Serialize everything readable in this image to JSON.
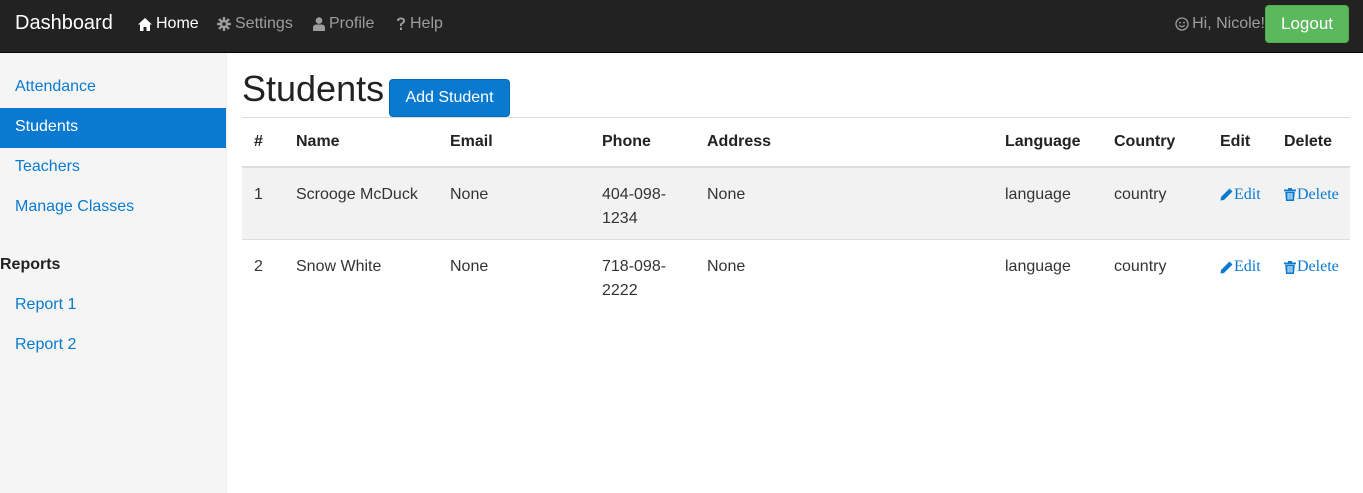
{
  "navbar": {
    "brand": "Dashboard",
    "items": [
      {
        "label": "Home",
        "icon": "home-icon",
        "active": true
      },
      {
        "label": "Settings",
        "icon": "gear-icon",
        "active": false
      },
      {
        "label": "Profile",
        "icon": "user-icon",
        "active": false
      },
      {
        "label": "Help",
        "icon": "question-icon",
        "active": false
      }
    ],
    "greeting": "Hi, Nicole!",
    "logout_label": "Logout"
  },
  "sidebar": {
    "items": [
      {
        "label": "Attendance",
        "active": false
      },
      {
        "label": "Students",
        "active": true
      },
      {
        "label": "Teachers",
        "active": false
      },
      {
        "label": "Manage Classes",
        "active": false
      }
    ],
    "reports_heading": "Reports",
    "reports": [
      {
        "label": "Report 1"
      },
      {
        "label": "Report 2"
      }
    ]
  },
  "main": {
    "title": "Students",
    "add_button": "Add Student",
    "table": {
      "headers": [
        "#",
        "Name",
        "Email",
        "Phone",
        "Address",
        "Language",
        "Country",
        "Edit",
        "Delete"
      ],
      "rows": [
        {
          "num": "1",
          "name": "Scrooge McDuck",
          "email": "None",
          "phone": "404-098-1234",
          "phone_line1": "404-098-",
          "phone_line2": "1234",
          "address": "None",
          "language": "language",
          "country": "country",
          "edit": "Edit",
          "delete": "Delete"
        },
        {
          "num": "2",
          "name": "Snow White",
          "email": "None",
          "phone": "718-098-2222",
          "phone_line1": "718-098-",
          "phone_line2": "2222",
          "address": "None",
          "language": "language",
          "country": "country",
          "edit": "Edit",
          "delete": "Delete"
        }
      ]
    }
  },
  "colors": {
    "navbar_bg": "#222222",
    "accent": "#0a7ad0",
    "logout_green": "#5cb85c",
    "sidebar_bg": "#f5f5f5"
  }
}
